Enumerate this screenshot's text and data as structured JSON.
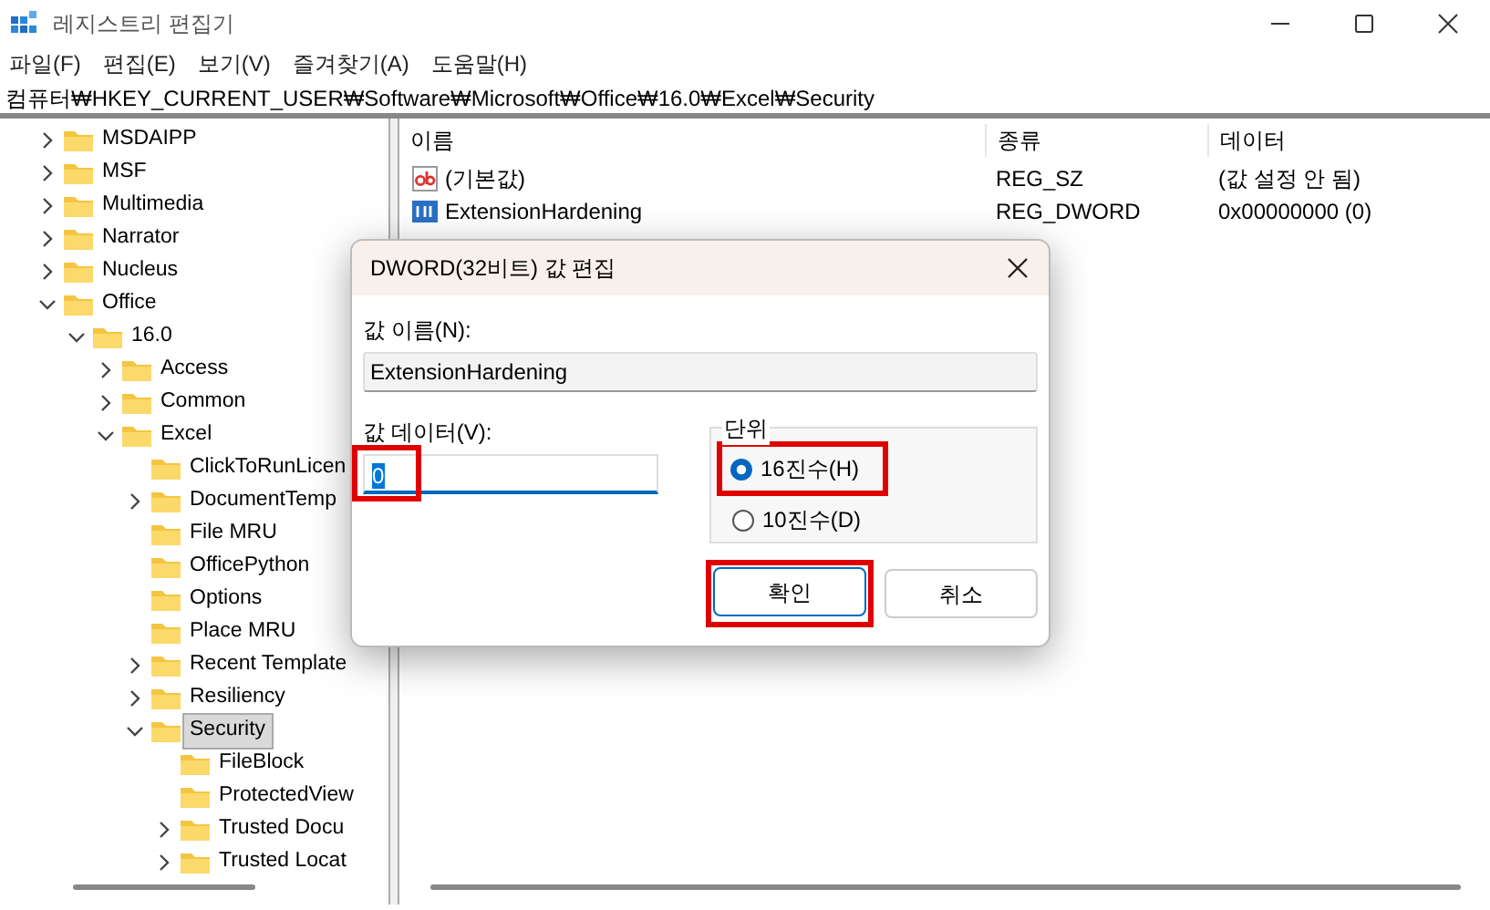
{
  "window": {
    "title": "레지스트리 편집기"
  },
  "menu": [
    "파일(F)",
    "편집(E)",
    "보기(V)",
    "즐겨찾기(A)",
    "도움말(H)"
  ],
  "address": "컴퓨터₩HKEY_CURRENT_USER₩Software₩Microsoft₩Office₩16.0₩Excel₩Security",
  "tree": [
    {
      "label": "MSDAIPP",
      "kind": "branch",
      "expanded": false,
      "selected": false
    },
    {
      "label": "MSF",
      "kind": "branch",
      "expanded": false,
      "selected": false
    },
    {
      "label": "Multimedia",
      "kind": "branch",
      "expanded": false,
      "selected": false
    },
    {
      "label": "Narrator",
      "kind": "branch",
      "expanded": false,
      "selected": false
    },
    {
      "label": "Nucleus",
      "kind": "branch",
      "expanded": false,
      "selected": false
    },
    {
      "label": "Office",
      "kind": "branch",
      "expanded": true,
      "selected": false,
      "children": [
        {
          "label": "16.0",
          "kind": "branch",
          "expanded": true,
          "selected": false,
          "children": [
            {
              "label": "Access",
              "kind": "branch",
              "expanded": false,
              "selected": false
            },
            {
              "label": "Common",
              "kind": "branch",
              "expanded": false,
              "selected": false
            },
            {
              "label": "Excel",
              "kind": "branch",
              "expanded": true,
              "selected": false,
              "children": [
                {
                  "label": "ClickToRunLicen",
                  "kind": "leaf",
                  "selected": false
                },
                {
                  "label": "DocumentTemp",
                  "kind": "branch",
                  "expanded": false,
                  "selected": false
                },
                {
                  "label": "File MRU",
                  "kind": "leaf",
                  "selected": false
                },
                {
                  "label": "OfficePython",
                  "kind": "leaf",
                  "selected": false
                },
                {
                  "label": "Options",
                  "kind": "leaf",
                  "selected": false
                },
                {
                  "label": "Place MRU",
                  "kind": "leaf",
                  "selected": false
                },
                {
                  "label": "Recent Template",
                  "kind": "branch",
                  "expanded": false,
                  "selected": false
                },
                {
                  "label": "Resiliency",
                  "kind": "branch",
                  "expanded": false,
                  "selected": false
                },
                {
                  "label": "Security",
                  "kind": "branch",
                  "expanded": true,
                  "selected": true,
                  "children": [
                    {
                      "label": "FileBlock",
                      "kind": "leaf",
                      "selected": false
                    },
                    {
                      "label": "ProtectedView",
                      "kind": "leaf",
                      "selected": false
                    },
                    {
                      "label": "Trusted Docu",
                      "kind": "branch",
                      "expanded": false,
                      "selected": false
                    },
                    {
                      "label": "Trusted Locat",
                      "kind": "branch",
                      "expanded": false,
                      "selected": false
                    }
                  ]
                }
              ]
            }
          ]
        }
      ]
    }
  ],
  "values": {
    "columns": [
      "이름",
      "종류",
      "데이터"
    ],
    "rows": [
      {
        "name": "(기본값)",
        "type": "REG_SZ",
        "data": "(값 설정 안 됨)",
        "kind": "string"
      },
      {
        "name": "ExtensionHardening",
        "type": "REG_DWORD",
        "data": "0x00000000 (0)",
        "kind": "dword"
      }
    ]
  },
  "dialog": {
    "title": "DWORD(32비트) 값 편집",
    "name_label": "값 이름(N):",
    "name_value": "ExtensionHardening",
    "data_label": "값 데이터(V):",
    "data_value": "0",
    "data_highlighted": true,
    "base": {
      "legend": "단위",
      "options": [
        {
          "label": "16진수(H)",
          "selected": true,
          "highlighted": true
        },
        {
          "label": "10진수(D)",
          "selected": false,
          "highlighted": false
        }
      ]
    },
    "buttons": [
      {
        "label": "확인",
        "default": true,
        "highlighted": true
      },
      {
        "label": "취소",
        "default": false,
        "highlighted": false
      }
    ]
  }
}
